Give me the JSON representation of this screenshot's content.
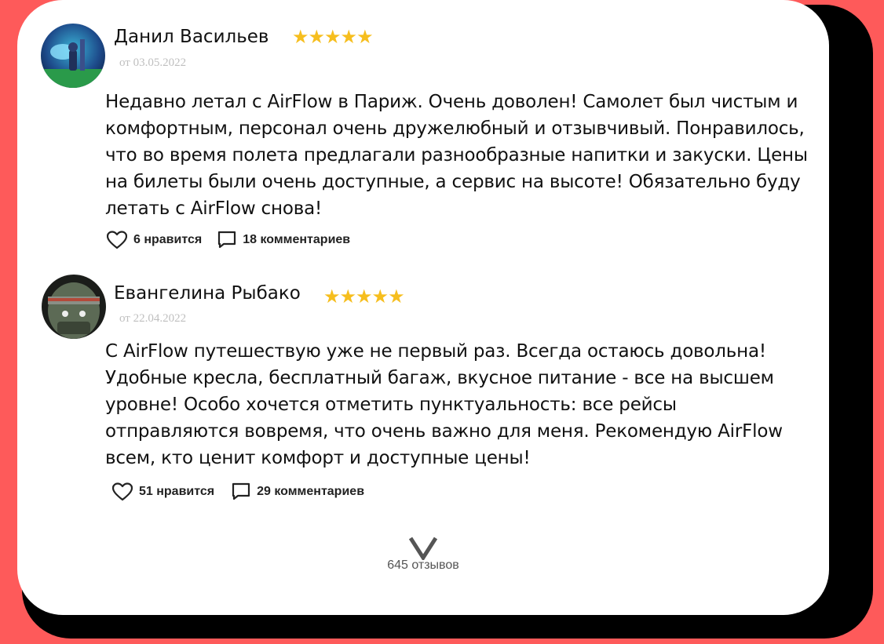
{
  "reviews": [
    {
      "author": "Данил Васильев",
      "stars": "★★★★★",
      "date": "от 03.05.2022",
      "text": "Недавно летал с AirFlow в Париж. Очень доволен! Самолет был чистым и комфортным, персонал очень дружелюбный и отзывчивый. Понравилось, что во время полета предлагали разнообразные напитки и закуски. Цены на билеты были очень доступные, а сервис на высоте! Обязательно буду летать с AirFlow снова!",
      "likes_label": "6 нравится",
      "comments_label": "18 комментариев"
    },
    {
      "author": "Евангелина Рыбако",
      "stars": "★★★★★",
      "date": "от 22.04.2022",
      "text": "С AirFlow путешествую уже не первый раз. Всегда остаюсь довольна! Удобные кресла, бесплатный багаж, вкусное питание - все на высшем уровне! Особо хочется отметить пунктуальность: все рейсы отправляются вовремя, что очень важно для меня. Рекомендую AirFlow всем, кто ценит комфорт и доступные цены!",
      "likes_label": "51 нравится",
      "comments_label": "29 комментариев"
    }
  ],
  "footer": {
    "reviews_count": "645 отзывов",
    "expand_icon": "chevron-down-icon"
  },
  "colors": {
    "background": "#fe5a5a",
    "card": "#ffffff",
    "star": "#f6be1e",
    "date": "#bfbfbf"
  }
}
